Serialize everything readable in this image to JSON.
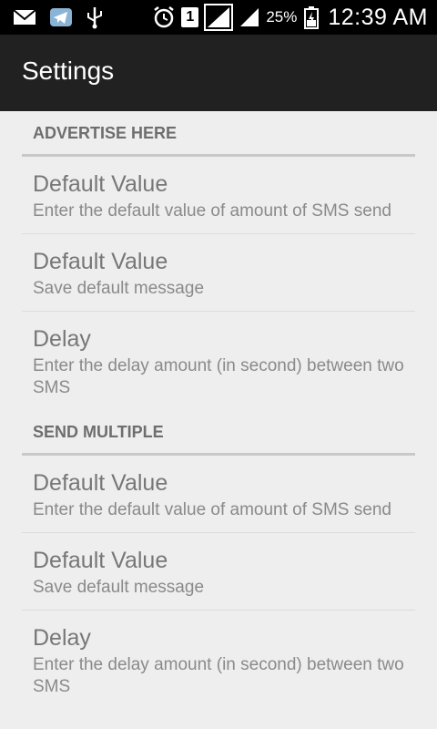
{
  "status_bar": {
    "icons_left": [
      "mail-icon",
      "telegram-icon",
      "usb-icon"
    ],
    "icons_right": [
      "alarm-icon",
      "sim-1-icon",
      "signal-icon",
      "signal-icon-2",
      "battery-icon"
    ],
    "sim_label": "1",
    "battery_percent": "25%",
    "time": "12:39 AM"
  },
  "action_bar": {
    "title": "Settings"
  },
  "sections": [
    {
      "header": "ADVERTISE HERE",
      "items": [
        {
          "title": "Default Value",
          "summary": "Enter the default value of amount of SMS send"
        },
        {
          "title": "Default Value",
          "summary": "Save default message"
        },
        {
          "title": "Delay",
          "summary": "Enter the delay amount (in second) between two SMS"
        }
      ]
    },
    {
      "header": "SEND MULTIPLE",
      "items": [
        {
          "title": "Default Value",
          "summary": "Enter the default value of amount of SMS send"
        },
        {
          "title": "Default Value",
          "summary": "Save default message"
        },
        {
          "title": "Delay",
          "summary": "Enter the delay amount (in second) between two SMS"
        }
      ]
    }
  ],
  "colors": {
    "status_bar": "#000000",
    "action_bar": "#212121",
    "background": "#eeeeee",
    "section_text": "#6e6e6e",
    "item_title": "#777777",
    "item_summary": "#8a8a8a"
  }
}
